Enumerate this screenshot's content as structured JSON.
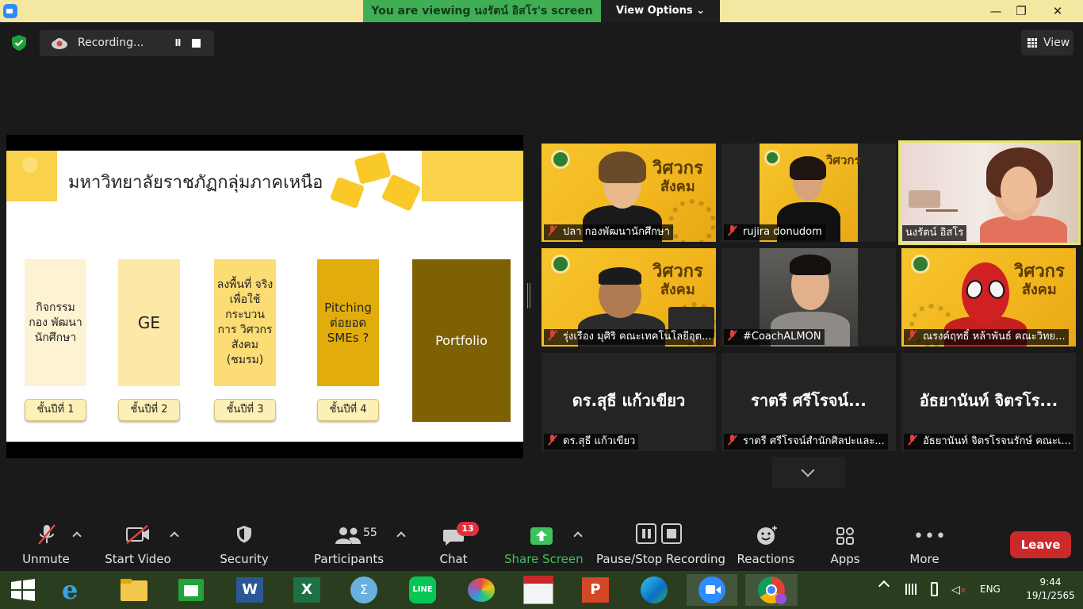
{
  "top_bar": {
    "banner": "You are viewing นงรัตน์ อิสโร's screen",
    "view_options": "View Options",
    "minimize": "—",
    "restore": "❐",
    "close": "✕"
  },
  "recording": {
    "label": "Recording...",
    "pause": "II"
  },
  "view_button": {
    "label": "View"
  },
  "slide": {
    "title": "มหาวิทยาลัยราชภัฏกลุ่มภาคเหนือ",
    "columns": [
      {
        "text": "กิจกรรม กอง พัฒนา นักศึกษา",
        "year": "ชั้นปีที่ 1",
        "color": "#fdf3d2"
      },
      {
        "text": "GE",
        "year": "ชั้นปีที่ 2",
        "color": "#fde8a8"
      },
      {
        "text": "ลงพื้นที่ จริงเพื่อใช้ กระบวน การ วิศวกร สังคม (ชมรม)",
        "year": "ชั้นปีที่ 3",
        "color": "#fcdc74"
      },
      {
        "text": "Pitching ต่อยอด SMEs ?",
        "year": "ชั้นปีที่ 4",
        "color": "#e2ad0c"
      }
    ],
    "portfolio": "Portfolio"
  },
  "gallery": [
    {
      "name": "ปลา กองพัฒนานักศึกษา"
    },
    {
      "name": "rujira donudom"
    },
    {
      "name": "นงรัตน์ อิสโร"
    },
    {
      "name": "รุ่งเรือง มุศิริ คณะเทคโนโลยีอุต..."
    },
    {
      "name": "#CoachALMON"
    },
    {
      "name": "ณรงค์ฤทธิ์ หล้าพันธ์ คณะวิทย..."
    },
    {
      "name": "ดร.สุธี แก้วเขียว",
      "display": "ดร.สุธี แก้วเขียว"
    },
    {
      "name": "ราตรี ศรีโรจน์สำนักศิลปะและ...",
      "display": "ราตรี ศรีโรจน์..."
    },
    {
      "name": "อัธยานันท์ จิตรโรจนรักษ์ คณะเ...",
      "display": "อัธยานันท์ จิตรโร..."
    }
  ],
  "video_brand": {
    "line1": "วิศวกร",
    "line2": "สังคม"
  },
  "toolbar": {
    "unmute": "Unmute",
    "start_video": "Start Video",
    "security": "Security",
    "participants": "Participants",
    "participants_count": "55",
    "chat": "Chat",
    "chat_badge": "13",
    "share_screen": "Share Screen",
    "pause_stop": "Pause/Stop Recording",
    "reactions": "Reactions",
    "apps": "Apps",
    "more": "More",
    "leave": "Leave"
  },
  "taskbar": {
    "lang": "ENG",
    "time": "9:44",
    "date": "19/1/2565",
    "apps": [
      "start-icon",
      "internet-explorer-icon",
      "file-explorer-icon",
      "store-icon",
      "word-icon",
      "excel-icon",
      "math-input-icon",
      "line-icon",
      "paint-icon",
      "lisrel-icon",
      "powerpoint-icon",
      "edge-icon",
      "zoom-icon",
      "chrome-icon"
    ]
  },
  "colors": {
    "banner": "#3fae55",
    "accent_yellow": "#f9c92a",
    "leave": "#cc2a2a",
    "share_screen": "#3fc25b"
  }
}
